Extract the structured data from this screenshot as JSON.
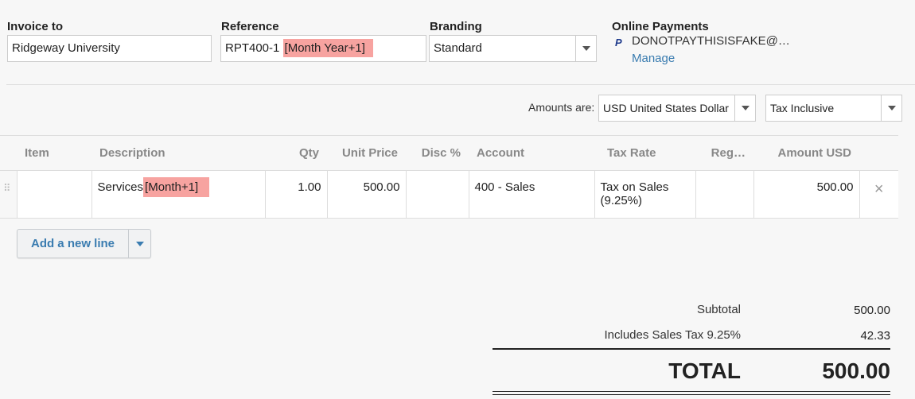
{
  "header": {
    "invoice_to": {
      "label": "Invoice to",
      "value": "Ridgeway University"
    },
    "reference": {
      "label": "Reference",
      "prefix": "RPT400-1",
      "highlight": "[Month Year+1]"
    },
    "branding": {
      "label": "Branding",
      "value": "Standard"
    },
    "online_payments": {
      "label": "Online Payments",
      "icon": "paypal-icon",
      "email": "DONOTPAYTHISISFAKE@…",
      "manage": "Manage"
    }
  },
  "options": {
    "amounts_label": "Amounts are:",
    "currency": "USD United States Dollar",
    "tax_mode": "Tax Inclusive"
  },
  "table": {
    "columns": [
      "Item",
      "Description",
      "Qty",
      "Unit Price",
      "Disc %",
      "Account",
      "Tax Rate",
      "Reg…",
      "Amount USD"
    ],
    "rows": [
      {
        "item": "",
        "description": "Services",
        "description_highlight": "[Month+1]",
        "qty": "1.00",
        "unit_price": "500.00",
        "disc": "",
        "account": "400 - Sales",
        "tax_rate": "Tax on Sales (9.25%)",
        "region": "",
        "amount": "500.00"
      }
    ]
  },
  "add_line": {
    "label": "Add a new line"
  },
  "totals": {
    "subtotal_label": "Subtotal",
    "subtotal": "500.00",
    "tax_label": "Includes Sales Tax 9.25%",
    "tax": "42.33",
    "total_label": "TOTAL",
    "total": "500.00"
  },
  "colors": {
    "highlight": "#f7a3a0",
    "link": "#3a7cb0"
  }
}
